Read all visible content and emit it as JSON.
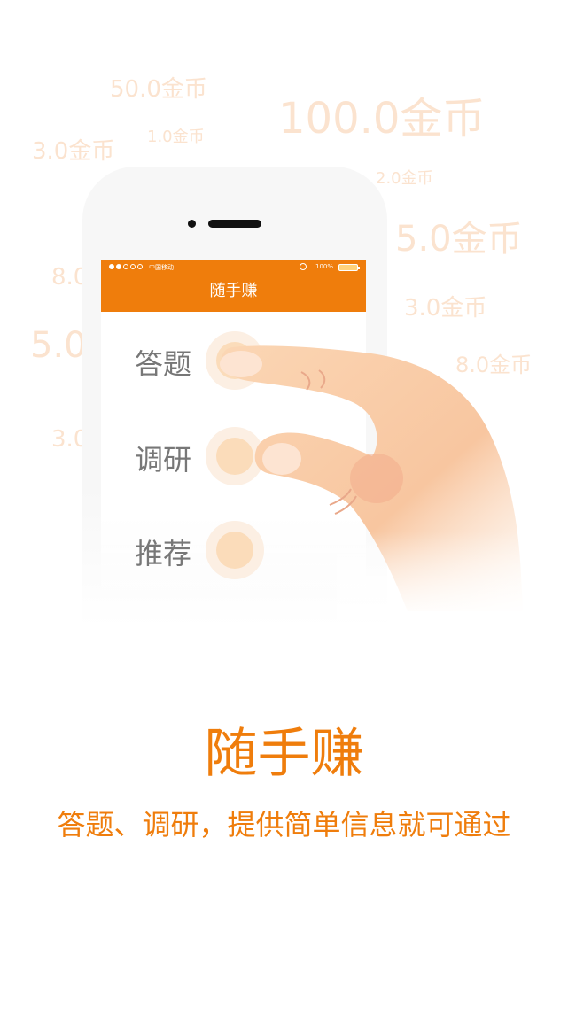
{
  "background_coins": [
    "50.0金币",
    "100.0金币",
    "3.0金币",
    "1.0金币",
    "2.0金币",
    "5.0金币",
    "8.0",
    "3.0金币",
    "5.0",
    "8.0金币",
    "3.0"
  ],
  "phone": {
    "status_bar": {
      "carrier": "中国移动",
      "battery": "100%"
    },
    "nav_title": "随手赚",
    "menu_items": [
      {
        "label": "答题"
      },
      {
        "label": "调研"
      },
      {
        "label": "推荐"
      }
    ]
  },
  "headline": "随手赚",
  "tagline": "答题、调研，提供简单信息就可通过",
  "colors": {
    "accent": "#ef7d0c",
    "coin_text": "#fbe3cf",
    "ring": "#fbdcba"
  }
}
